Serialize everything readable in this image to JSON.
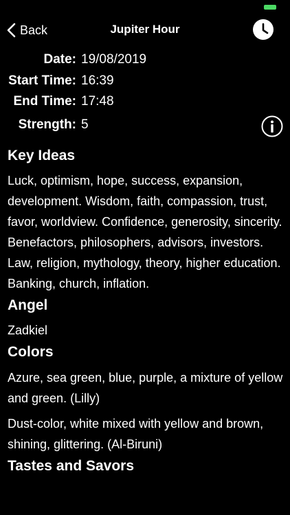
{
  "nav": {
    "back_label": "Back",
    "title": "Jupiter Hour",
    "back_icon": "chevron-left-icon",
    "clock_icon": "clock-icon"
  },
  "info": {
    "date_label": "Date:",
    "date_value": "19/08/2019",
    "start_label": "Start Time:",
    "start_value": "16:39",
    "end_label": "End Time:",
    "end_value": "17:48",
    "strength_label": "Strength:",
    "strength_value": "5",
    "info_icon": "info-icon"
  },
  "sections": {
    "key_ideas_title": "Key Ideas",
    "key_ideas_text": "Luck, optimism, hope, success, expansion, development. Wisdom, faith, compassion, trust, favor, worldview. Confidence, generosity, sincerity. Benefactors, philosophers, advisors, investors. Law, religion, mythology, theory, higher education. Banking, church, inflation.",
    "angel_title": "Angel",
    "angel_text": "Zadkiel",
    "colors_title": "Colors",
    "colors_text_1": "Azure, sea green, blue, purple, a mixture of yellow and green. (Lilly)",
    "colors_text_2": "Dust-color, white mixed with yellow and brown, shining, glittering. (Al-Biruni)",
    "tastes_title": "Tastes and Savors"
  },
  "colors": {
    "background": "#000000",
    "text": "#ffffff",
    "battery": "#4cd964"
  }
}
